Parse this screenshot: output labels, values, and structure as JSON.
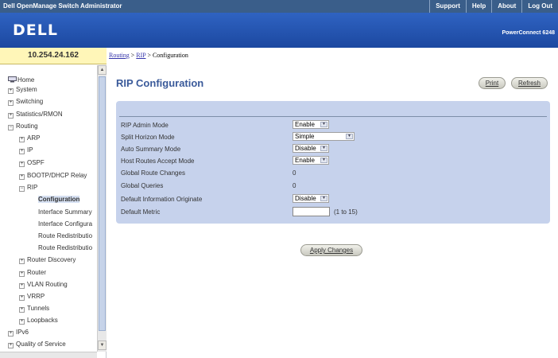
{
  "header": {
    "app_title": "Dell OpenManage Switch Administrator",
    "nav": [
      "Support",
      "Help",
      "About",
      "Log Out"
    ],
    "logo": "DELL",
    "product": "PowerConnect 6248"
  },
  "device_ip": "10.254.24.162",
  "breadcrumb": {
    "routing": "Routing",
    "sep1": " > ",
    "rip": "RIP",
    "sep2": " > ",
    "current": "Configuration"
  },
  "sidebar": {
    "home": "Home",
    "system": "System",
    "switching": "Switching",
    "stats": "Statistics/RMON",
    "routing": "Routing",
    "arp": "ARP",
    "ip": "IP",
    "ospf": "OSPF",
    "bootp": "BOOTP/DHCP Relay",
    "rip": "RIP",
    "rip_config": "Configuration",
    "rip_iface_summary": "Interface Summary",
    "rip_iface_config": "Interface Configura",
    "route_redist1": "Route Redistributio",
    "route_redist2": "Route Redistributio",
    "router_discovery": "Router Discovery",
    "router": "Router",
    "vlan_routing": "VLAN Routing",
    "vrrp": "VRRP",
    "tunnels": "Tunnels",
    "loopbacks": "Loopbacks",
    "ipv6": "IPv6",
    "qos": "Quality of Service"
  },
  "page": {
    "title": "RIP Configuration",
    "print": "Print",
    "refresh": "Refresh",
    "apply": "Apply Changes"
  },
  "form": {
    "admin_mode_label": "RIP Admin Mode",
    "admin_mode_value": "Enable",
    "split_horizon_label": "Split Horizon Mode",
    "split_horizon_value": "Simple",
    "auto_summary_label": "Auto Summary Mode",
    "auto_summary_value": "Disable",
    "host_routes_label": "Host Routes Accept Mode",
    "host_routes_value": "Enable",
    "global_route_changes_label": "Global Route Changes",
    "global_route_changes_value": "0",
    "global_queries_label": "Global Queries",
    "global_queries_value": "0",
    "default_info_label": "Default Information Originate",
    "default_info_value": "Disable",
    "default_metric_label": "Default Metric",
    "default_metric_value": "",
    "default_metric_hint": "(1 to 15)"
  },
  "colors": {
    "topbar": "#3a5e8a",
    "banner": "#2457b4",
    "panel": "#c6d2ec",
    "title": "#3a5a9a",
    "ip_box": "#fff6b8"
  }
}
